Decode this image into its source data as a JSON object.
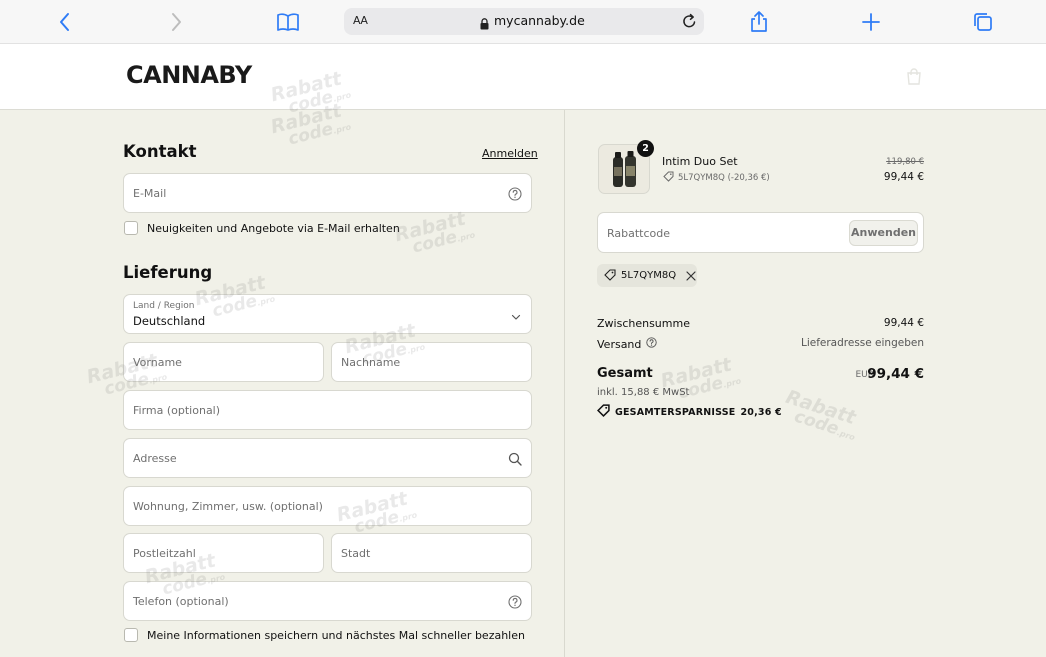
{
  "browser": {
    "url": "mycannaby.de",
    "aa_label": "AA"
  },
  "header": {
    "logo": "CANNABY"
  },
  "contact": {
    "title": "Kontakt",
    "login_link": "Anmelden",
    "email_placeholder": "E-Mail",
    "newsletter_label": "Neuigkeiten und Angebote via E-Mail erhalten"
  },
  "delivery": {
    "title": "Lieferung",
    "country_label": "Land / Region",
    "country_value": "Deutschland",
    "first_name_placeholder": "Vorname",
    "last_name_placeholder": "Nachname",
    "company_placeholder": "Firma (optional)",
    "address_placeholder": "Adresse",
    "apartment_placeholder": "Wohnung, Zimmer, usw. (optional)",
    "postal_placeholder": "Postleitzahl",
    "city_placeholder": "Stadt",
    "phone_placeholder": "Telefon (optional)",
    "save_info_label": "Meine Informationen speichern und nächstes Mal schneller bezahlen"
  },
  "order": {
    "product": {
      "quantity": "2",
      "name": "Intim Duo Set",
      "discount": "5L7QYM8Q (-20,36 €)",
      "old_price": "119,80 €",
      "price": "99,44 €"
    },
    "discount_placeholder": "Rabattcode",
    "apply_button": "Anwenden",
    "applied_code": "5L7QYM8Q",
    "subtotal_label": "Zwischensumme",
    "subtotal_value": "99,44 €",
    "shipping_label": "Versand",
    "shipping_value": "Lieferadresse eingeben",
    "total_label": "Gesamt",
    "total_currency": "EUR",
    "total_value": "99,44 €",
    "tax_line": "inkl. 15,88 € MwSt",
    "savings_label": "GESAMTERSPARNISSE",
    "savings_value": "20,36 €"
  },
  "watermark": {
    "line1": "Rabatt",
    "line2": "code",
    "suffix": ".pro"
  }
}
